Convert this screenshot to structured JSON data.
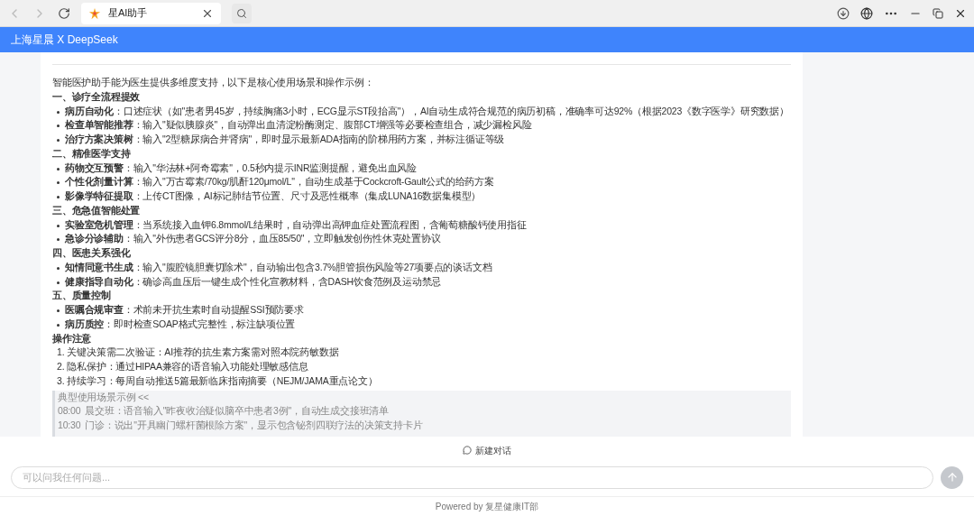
{
  "browser": {
    "tab": {
      "title": "星AI助手",
      "selected": true
    }
  },
  "header": {
    "title": "上海星晨 X DeepSeek"
  },
  "message": {
    "intro": "智能医护助手能为医生提供多维度支持，以下是核心使用场景和操作示例：",
    "sections": [
      {
        "heading": "一、诊疗全流程提效",
        "items": [
          {
            "label": "病历自动化",
            "text": "：口述症状（如\"患者男45岁，持续胸痛3小时，ECG显示ST段抬高\"），AI自动生成符合规范的病历初稿，准确率可达92%（根据2023《数字医学》研究数据）"
          },
          {
            "label": "检查单智能推荐",
            "text": "：输入\"疑似胰腺炎\"，自动弹出血清淀粉酶测定、腹部CT增强等必要检查组合，减少漏检风险"
          },
          {
            "label": "治疗方案决策树",
            "text": "：输入\"2型糖尿病合并肾病\"，即时显示最新ADA指南的阶梯用药方案，并标注循证等级"
          }
        ]
      },
      {
        "heading": "二、精准医学支持",
        "items": [
          {
            "label": "药物交互预警",
            "text": "：输入\"华法林+阿奇霉素\"，0.5秒内提示INR监测提醒，避免出血风险"
          },
          {
            "label": "个性化剂量计算",
            "text": "：输入\"万古霉素/70kg/肌酐120μmol/L\"，自动生成基于Cockcroft-Gault公式的给药方案"
          },
          {
            "label": "影像学特征提取",
            "text": "：上传CT图像，AI标记肺结节位置、尺寸及恶性概率（集成LUNA16数据集模型）"
          }
        ]
      },
      {
        "heading": "三、危急值智能处置",
        "items": [
          {
            "label": "实验室危机管理",
            "text": "：当系统接入血钾6.8mmol/L结果时，自动弹出高钾血症处置流程图，含葡萄糖酸钙使用指征"
          },
          {
            "label": "急诊分诊辅助",
            "text": "：输入\"外伤患者GCS评分8分，血压85/50\"，立即触发创伤性休克处置协议"
          }
        ]
      },
      {
        "heading": "四、医患关系强化",
        "items": [
          {
            "label": "知情同意书生成",
            "text": "：输入\"腹腔镜胆囊切除术\"，自动输出包含3.7%胆管损伤风险等27项要点的谈话文档"
          },
          {
            "label": "健康指导自动化",
            "text": "：确诊高血压后一键生成个性化宣教材料，含DASH饮食范例及运动禁忌"
          }
        ]
      },
      {
        "heading": "五、质量控制",
        "items": [
          {
            "label": "医嘱合规审查",
            "text": "：术前未开抗生素时自动提醒SSI预防要求"
          },
          {
            "label": "病历质控",
            "text": "：即时检查SOAP格式完整性，标注缺项位置"
          }
        ]
      }
    ],
    "notes_heading": "操作注意",
    "notes": [
      {
        "number": "1.",
        "text": "关键决策需二次验证：AI推荐的抗生素方案需对照本院药敏数据"
      },
      {
        "number": "2.",
        "text": "隐私保护：通过HIPAA兼容的语音输入功能处理敏感信息"
      },
      {
        "number": "3.",
        "text": "持续学习：每周自动推送5篇最新临床指南摘要（NEJM/JAMA重点论文）"
      }
    ],
    "quote": {
      "title": "典型使用场景示例  <<",
      "lines": [
        {
          "time": "08:00",
          "text": "晨交班：语音输入\"昨夜收治疑似脑卒中患者3例\"，自动生成交接班清单"
        },
        {
          "time": "10:30",
          "text": "门诊：说出\"开具幽门螺杆菌根除方案\"，显示包含铋剂四联疗法的决策支持卡片"
        }
      ]
    }
  },
  "new_chat": "新建对话",
  "input": {
    "placeholder": "可以问我任何问题..."
  },
  "footer": "Powered by 复星健康IT部"
}
